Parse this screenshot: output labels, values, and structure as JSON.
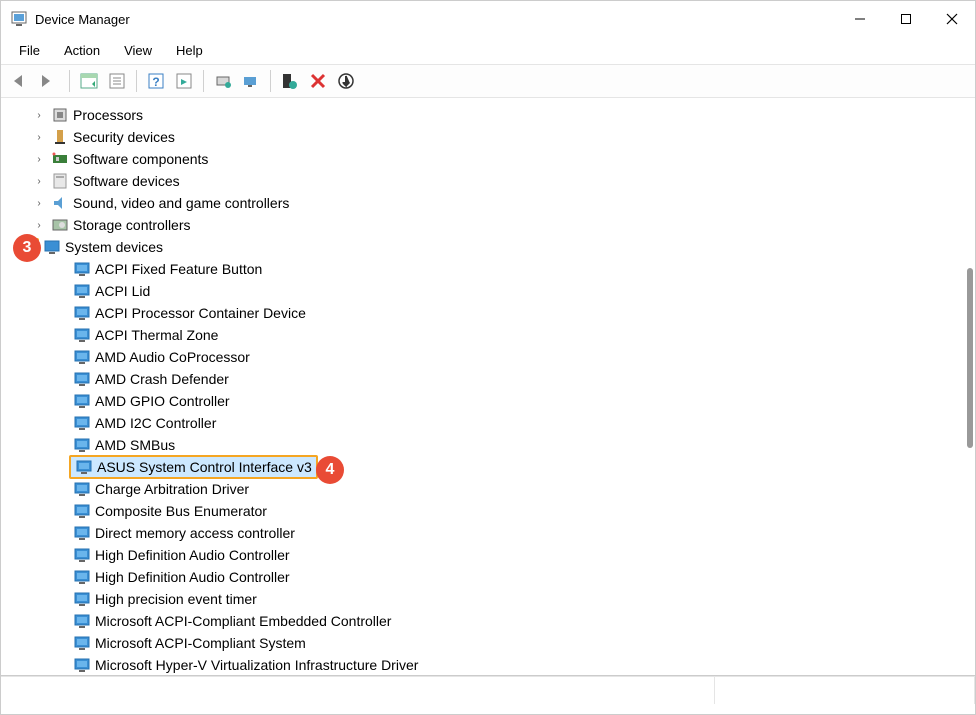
{
  "window": {
    "title": "Device Manager"
  },
  "menu": {
    "file": "File",
    "action": "Action",
    "view": "View",
    "help": "Help"
  },
  "categories": [
    {
      "label": "Processors",
      "icon": "cpu"
    },
    {
      "label": "Security devices",
      "icon": "security"
    },
    {
      "label": "Software components",
      "icon": "component"
    },
    {
      "label": "Software devices",
      "icon": "software"
    },
    {
      "label": "Sound, video and game controllers",
      "icon": "sound"
    },
    {
      "label": "Storage controllers",
      "icon": "storage"
    },
    {
      "label": "System devices",
      "icon": "system",
      "expanded": true
    }
  ],
  "system_devices": [
    "ACPI Fixed Feature Button",
    "ACPI Lid",
    "ACPI Processor Container Device",
    "ACPI Thermal Zone",
    "AMD Audio CoProcessor",
    "AMD Crash Defender",
    "AMD GPIO Controller",
    "AMD I2C Controller",
    "AMD SMBus",
    "ASUS System Control Interface v3",
    "Charge Arbitration Driver",
    "Composite Bus Enumerator",
    "Direct memory access controller",
    "High Definition Audio Controller",
    "High Definition Audio Controller",
    "High precision event timer",
    "Microsoft ACPI-Compliant Embedded Controller",
    "Microsoft ACPI-Compliant System",
    "Microsoft Hyper-V Virtualization Infrastructure Driver"
  ],
  "callouts": {
    "expand": "3",
    "highlight": "4"
  },
  "highlighted_index": 9
}
